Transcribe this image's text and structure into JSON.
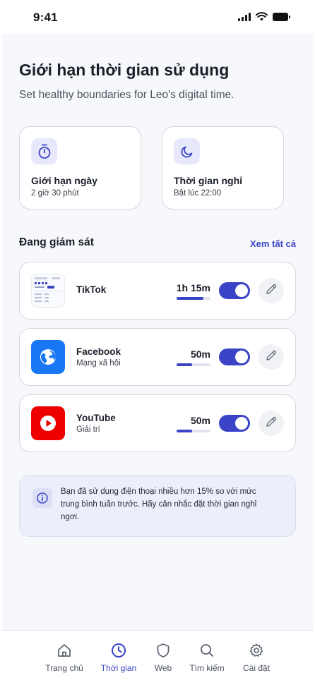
{
  "status_bar": {
    "time": "9:41"
  },
  "header": {
    "title": "Giới hạn thời gian sử dụng",
    "subtitle": "Set healthy boundaries for Leo's digital time."
  },
  "quick_cards": [
    {
      "icon": "timer-icon",
      "title": "Giới hạn ngày",
      "subtitle": "2 giờ 30 phút"
    },
    {
      "icon": "moon-icon",
      "title": "Thời gian nghỉ",
      "subtitle": "Bật lúc 22:00"
    }
  ],
  "monitoring": {
    "title": "Đang giám sát",
    "see_all": "Xem tất cả",
    "apps": [
      {
        "name": "TikTok",
        "category": "",
        "usage": "1h 15m",
        "usage_fraction": 0.8,
        "enabled": true,
        "icon": "tiktok-thumbnail-icon"
      },
      {
        "name": "Facebook",
        "category": "Mạng xã hội",
        "usage": "50m",
        "usage_fraction": 0.45,
        "enabled": true,
        "icon": "globe-icon"
      },
      {
        "name": "YouTube",
        "category": "Giải trí",
        "usage": "50m",
        "usage_fraction": 0.45,
        "enabled": true,
        "icon": "play-icon"
      }
    ]
  },
  "alert": {
    "icon": "info-icon",
    "text": "Bạn đã sử dụng điện thoại nhiều hơn 15% so với mức trung bình tuần trước. Hãy cân nhắc đặt thời gian nghỉ ngơi."
  },
  "tabs": [
    {
      "label": "Trang chủ",
      "icon": "home-icon",
      "active": false
    },
    {
      "label": "Thời gian",
      "icon": "clock-icon",
      "active": true
    },
    {
      "label": "Web",
      "icon": "shield-icon",
      "active": false
    },
    {
      "label": "Tìm kiếm",
      "icon": "search-icon",
      "active": false
    },
    {
      "label": "Cài đặt",
      "icon": "gear-icon",
      "active": false
    }
  ],
  "colors": {
    "accent": "#3b44c6",
    "facebook": "#1877f2",
    "youtube": "#ee0000",
    "background": "#f7f8fb"
  }
}
